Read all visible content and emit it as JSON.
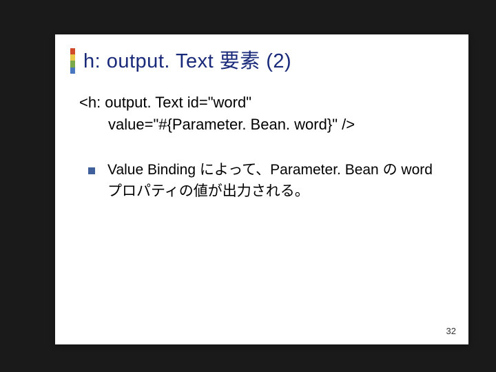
{
  "title": "h: output. Text 要素 (2)",
  "code": {
    "line1": "<h: output. Text id=\"word\"",
    "line2": "value=\"#{Parameter. Bean. word}\" />"
  },
  "bullet": "Value Binding によって、Parameter. Bean の word プロパティの値が出力される。",
  "pageNumber": "32"
}
